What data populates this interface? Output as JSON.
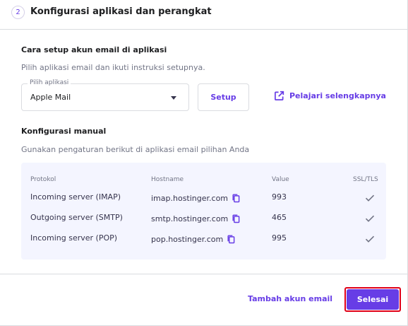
{
  "header": {
    "step": "2",
    "title": "Konfigurasi aplikasi dan perangkat"
  },
  "setup": {
    "title": "Cara setup akun email di aplikasi",
    "subtitle": "Pilih aplikasi email dan ikuti instruksi setupnya.",
    "select_label": "Pilih aplikasi",
    "select_value": "Apple Mail",
    "setup_button": "Setup",
    "learn_more": "Pelajari selengkapnya"
  },
  "manual": {
    "title": "Konfigurasi manual",
    "subtitle": "Gunakan pengaturan berikut di aplikasi email pilihan Anda",
    "columns": {
      "protocol": "Protokol",
      "hostname": "Hostname",
      "value": "Value",
      "ssl": "SSL/TLS"
    },
    "rows": [
      {
        "protocol": "Incoming server (IMAP)",
        "hostname": "imap.hostinger.com",
        "value": "993",
        "ssl": true
      },
      {
        "protocol": "Outgoing server (SMTP)",
        "hostname": "smtp.hostinger.com",
        "value": "465",
        "ssl": true
      },
      {
        "protocol": "Incoming server (POP)",
        "hostname": "pop.hostinger.com",
        "value": "995",
        "ssl": true
      }
    ]
  },
  "footer": {
    "add_email": "Tambah akun email",
    "done": "Selesai"
  },
  "colors": {
    "accent": "#673de6",
    "highlight_outline": "#e00018",
    "table_bg": "#f4f5ff"
  },
  "icons": {
    "copy": "copy-icon",
    "check": "check-icon",
    "external_link": "external-link-icon",
    "caret": "chevron-down-icon"
  }
}
